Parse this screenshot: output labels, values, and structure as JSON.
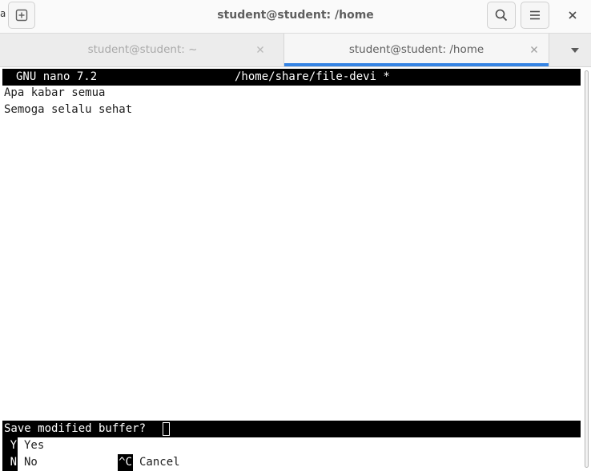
{
  "window": {
    "title": "student@student: /home",
    "left_edge_glyph": "a"
  },
  "headerbar": {
    "new_tab_icon": "plus-square-icon",
    "search_icon": "search-icon",
    "menu_icon": "hamburger-menu-icon",
    "close_icon": "close-icon"
  },
  "tabs": [
    {
      "label": "student@student: ~",
      "active": false,
      "close_icon": "close-icon"
    },
    {
      "label": "student@student: /home",
      "active": true,
      "close_icon": "close-icon"
    }
  ],
  "tab_dropdown_icon": "chevron-down-icon",
  "colors": {
    "accent": "#3584e4",
    "terminal_bg": "#ffffff",
    "terminal_fg": "#1e1e1e",
    "inverse_bg": "#000000",
    "inverse_fg": "#ffffff"
  },
  "nano": {
    "version": "GNU nano 7.2",
    "filename": "/home/share/file-devi *",
    "buffer": [
      "Apa kabar semua",
      "Semoga selalu sehat"
    ],
    "prompt": "Save modified buffer?",
    "options": [
      {
        "key": "Y",
        "label": "Yes"
      },
      {
        "key": "N",
        "label": "No"
      },
      {
        "key": "^C",
        "label": "Cancel"
      }
    ]
  }
}
